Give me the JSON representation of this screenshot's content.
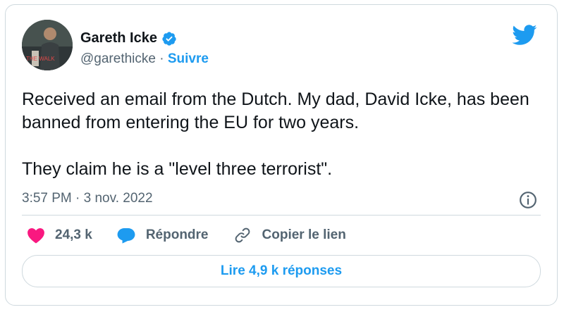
{
  "author": {
    "name": "Gareth Icke",
    "handle": "@garethicke",
    "separator": "·",
    "follow_label": "Suivre",
    "avatar_text": "THE WALK"
  },
  "tweet": {
    "paragraph1": "Received an email from the Dutch. My dad, David Icke, has been banned from entering the EU for two years.",
    "paragraph2": "They claim he is a \"level three terrorist\".",
    "timestamp": "3:57 PM · 3 nov. 2022"
  },
  "actions": {
    "likes": "24,3 k",
    "reply_label": "Répondre",
    "copy_link_label": "Copier le lien"
  },
  "replies_button": "Lire 4,9 k réponses",
  "colors": {
    "brand_blue": "#1d9bf0",
    "heart_pink": "#f91880",
    "text_gray": "#536471",
    "border": "#cfd9de"
  },
  "icons": [
    "verified-badge-icon",
    "twitter-bird-icon",
    "info-icon",
    "heart-icon",
    "reply-bubble-icon",
    "link-icon"
  ]
}
